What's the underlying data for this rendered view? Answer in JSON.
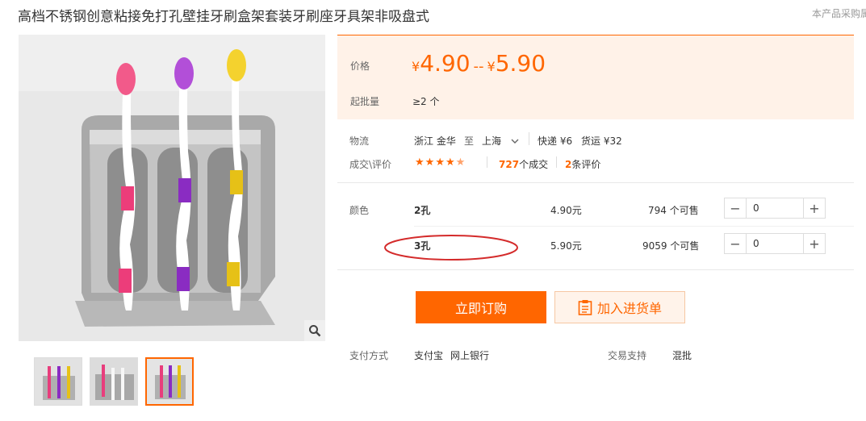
{
  "product": {
    "title": "高档不锈钢创意粘接免打孔壁挂牙刷盒架套装牙刷座牙具架非吸盘式",
    "note": "本产品采购属"
  },
  "price_box": {
    "price_label": "价格",
    "currency": "¥",
    "price_low": "4.90",
    "price_separator": "--",
    "price_high": "5.90",
    "moq_label": "起批量",
    "moq_value": "≥2 个"
  },
  "logistics": {
    "label": "物流",
    "from": "浙江 金华",
    "to_word": "至",
    "to": "上海",
    "express": "快递 ¥6",
    "freight": "货运 ¥32"
  },
  "deals": {
    "label": "成交\\评价",
    "rating": 4.5,
    "deal_count": "727",
    "deal_suffix": "个成交",
    "review_count": "2",
    "review_suffix": "条评价"
  },
  "sku": {
    "label": "颜色",
    "rows": [
      {
        "name": "2孔",
        "price": "4.90元",
        "stock": "794 个可售",
        "qty": "0"
      },
      {
        "name": "3孔",
        "price": "5.90元",
        "stock": "9059 个可售",
        "qty": "0"
      }
    ]
  },
  "actions": {
    "buy": "立即订购",
    "cart": "加入进货单"
  },
  "payment": {
    "label": "支付方式",
    "methods": [
      "支付宝",
      "网上银行"
    ],
    "trade_label": "交易支持",
    "trade_value": "混批"
  },
  "colors": {
    "accent": "#ff6600",
    "annotation": "#d42b2b"
  }
}
